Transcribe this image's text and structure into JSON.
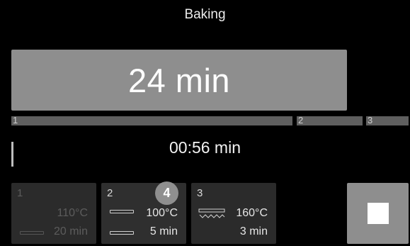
{
  "header": {
    "title": "Baking"
  },
  "duration": {
    "value": "24 min"
  },
  "segments": [
    {
      "label": "1"
    },
    {
      "label": "2"
    },
    {
      "label": "3"
    }
  ],
  "remaining": {
    "value": "00:56 min"
  },
  "steps": [
    {
      "number": "1",
      "temperature": "110°C",
      "time": "20 min"
    },
    {
      "number": "2",
      "temperature": "100°C",
      "time": "5 min"
    },
    {
      "number": "3",
      "temperature": "160°C",
      "time": "3 min"
    }
  ],
  "badge": {
    "value": "4"
  },
  "controls": {
    "stop_icon": "stop-square-icon"
  },
  "colors": {
    "background": "#000000",
    "panel": "#8e8e8e",
    "step_bg": "#2b2b2b"
  }
}
